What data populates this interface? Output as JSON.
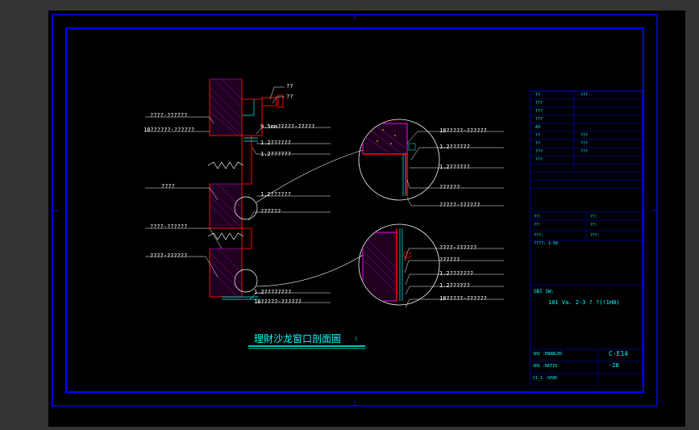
{
  "drawing": {
    "title": "理財沙龙窗口剖面圖",
    "title_suffix": ")",
    "section_labels": {
      "top_note1": "??",
      "top_note2": "??",
      "l_note1": "????-??????",
      "l_note2": "18??????-??????",
      "l_note3": "????",
      "l_note4": "????-??????",
      "l_note5": "????-??????",
      "r_note1": "9.5mm?????-?????",
      "r_note2": "1.2??????",
      "r_note3": "1.2??????",
      "r_note4": "1.2??????",
      "r_note5": "??????",
      "r_note6": "1.2????????",
      "r_note7": "18?????-??????"
    },
    "detail_a": {
      "n1": "18?????-??????",
      "n2": "1.2??????",
      "n3": "1.2??????",
      "n4": "??????",
      "n5": "?????-??????"
    },
    "detail_b": {
      "n1": "????-??????",
      "n2": "??????",
      "n3": "1.2???????",
      "n4": "1.2??????",
      "n5": "18?????-??????"
    }
  },
  "titleblock": {
    "software_note": "101 Va. 2-3 ? ?(!1H8)",
    "hdr1": "??",
    "hdr2": "???",
    "row1": "???",
    "row2": "???",
    "row3": "???",
    "row4": "A3",
    "row5a": "??",
    "row5b": "???",
    "row6a": "??",
    "row6b": "???",
    "row7a": "???",
    "row7b": "???",
    "row8": "???",
    "prj1": "??:",
    "prj2": "??:",
    "prj3": "??:",
    "prj4": "??:",
    "num_lbl": "???:",
    "date_lbl": "???:",
    "scale_lbl": "????:",
    "scale_val": "1:50",
    "foot_lbl1": "SH2 :ENABLED",
    "foot_val1": "C-E14",
    "foot_lbl2": "SH1 :RATIO",
    "foot_val2": "-28",
    "foot_lbl3": "C1_1 :SPAD",
    "sw_hdr": "GBI SW:"
  }
}
